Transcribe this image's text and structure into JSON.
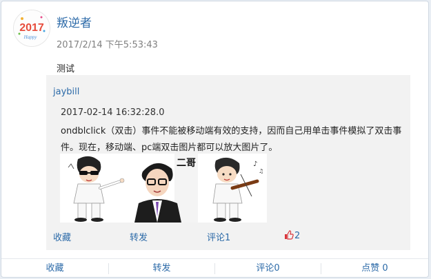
{
  "post": {
    "username": "叛逆者",
    "time": "2017/2/14 下午5:53:43",
    "text": "测试",
    "avatar_text": "2017",
    "avatar_sub": "Happy"
  },
  "repost": {
    "author": "jaybill",
    "time": "2017-02-14 16:32:28.0",
    "body": "ondblclick（双击）事件不能被移动端有效的支持，因而自己用单击事件模拟了双击事件。现在，移动端、pc端双击图片都可以放大图片了。",
    "images": [
      {
        "name": "cartoon-singer-image"
      },
      {
        "name": "glasses-man-image",
        "poster_text": "二哥"
      },
      {
        "name": "violinist-image"
      }
    ],
    "actions": {
      "favorite": "收藏",
      "forward": "转发",
      "comment": "评论1",
      "like_count": "2"
    }
  },
  "footer": {
    "favorite": "收藏",
    "forward": "转发",
    "comment": "评论0",
    "like": "点赞 0"
  },
  "colors": {
    "link": "#2c6aa8",
    "like_icon": "#d9343a",
    "repost_bg": "#f2f2f2"
  }
}
